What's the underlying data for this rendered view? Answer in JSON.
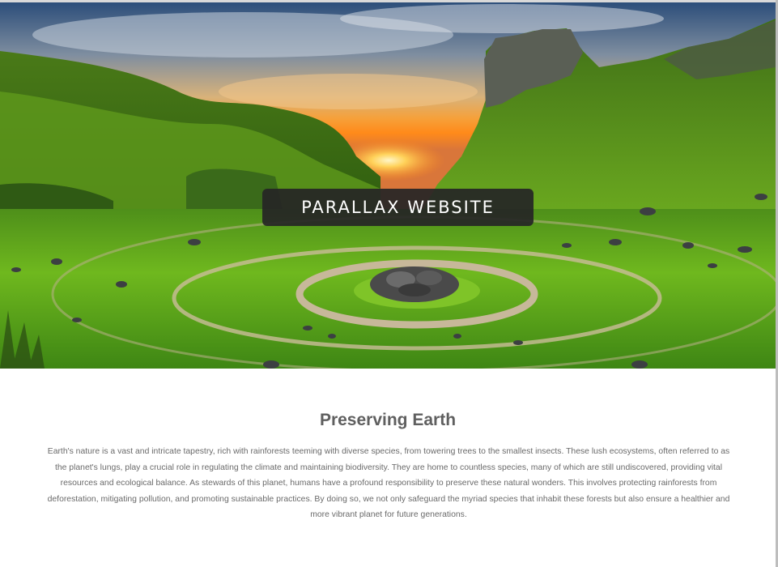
{
  "hero": {
    "title": "PARALLAX WEBSITE"
  },
  "section": {
    "heading": "Preserving Earth",
    "body": "Earth's nature is a vast and intricate tapestry, rich with rainforests teeming with diverse species, from towering trees to the smallest insects. These lush ecosystems, often referred to as the planet's lungs, play a crucial role in regulating the climate and maintaining biodiversity. They are home to countless species, many of which are still undiscovered, providing vital resources and ecological balance. As stewards of this planet, humans have a profound responsibility to preserve these natural wonders. This involves protecting rainforests from deforestation, mitigating pollution, and promoting sustainable practices. By doing so, we not only safeguard the myriad species that inhabit these forests but also ensure a healthier and more vibrant planet for future generations."
  },
  "colors": {
    "label_bg": "#262626",
    "heading": "#5f5f5f",
    "body_text": "#6a6a6a"
  }
}
